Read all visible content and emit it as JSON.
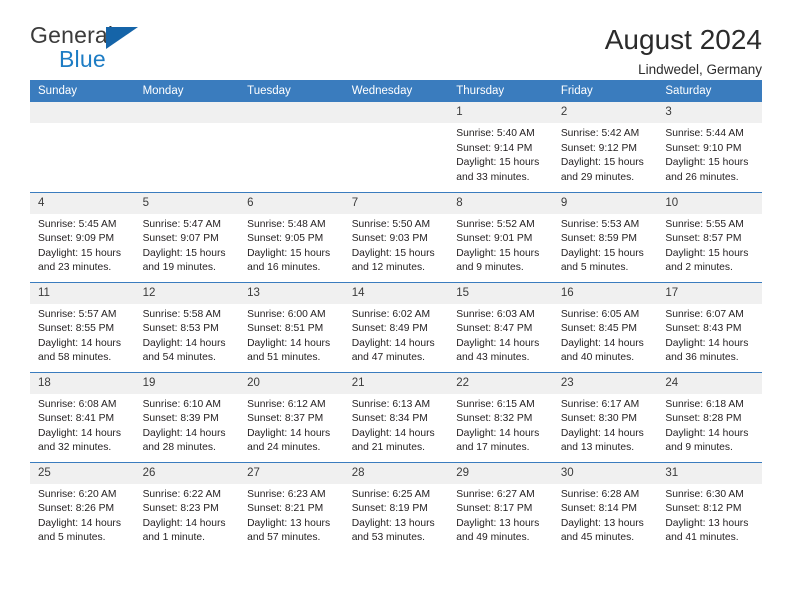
{
  "logo": {
    "word_one": "General",
    "word_two": "Blue",
    "triangle_icon": "blue-triangle-icon",
    "brand_color": "#1d7cc4"
  },
  "header": {
    "title": "August 2024",
    "subtitle": "Lindwedel, Germany"
  },
  "calendar": {
    "header_bg": "#3a7cbe",
    "daynum_bg": "#f0f0f0",
    "weekday_headers": [
      "Sunday",
      "Monday",
      "Tuesday",
      "Wednesday",
      "Thursday",
      "Friday",
      "Saturday"
    ],
    "weeks": [
      [
        {
          "day": "",
          "sunrise": "",
          "sunset": "",
          "daylight1": "",
          "daylight2": "",
          "empty": true
        },
        {
          "day": "",
          "sunrise": "",
          "sunset": "",
          "daylight1": "",
          "daylight2": "",
          "empty": true
        },
        {
          "day": "",
          "sunrise": "",
          "sunset": "",
          "daylight1": "",
          "daylight2": "",
          "empty": true
        },
        {
          "day": "",
          "sunrise": "",
          "sunset": "",
          "daylight1": "",
          "daylight2": "",
          "empty": true
        },
        {
          "day": "1",
          "sunrise": "Sunrise: 5:40 AM",
          "sunset": "Sunset: 9:14 PM",
          "daylight1": "Daylight: 15 hours",
          "daylight2": "and 33 minutes."
        },
        {
          "day": "2",
          "sunrise": "Sunrise: 5:42 AM",
          "sunset": "Sunset: 9:12 PM",
          "daylight1": "Daylight: 15 hours",
          "daylight2": "and 29 minutes."
        },
        {
          "day": "3",
          "sunrise": "Sunrise: 5:44 AM",
          "sunset": "Sunset: 9:10 PM",
          "daylight1": "Daylight: 15 hours",
          "daylight2": "and 26 minutes."
        }
      ],
      [
        {
          "day": "4",
          "sunrise": "Sunrise: 5:45 AM",
          "sunset": "Sunset: 9:09 PM",
          "daylight1": "Daylight: 15 hours",
          "daylight2": "and 23 minutes."
        },
        {
          "day": "5",
          "sunrise": "Sunrise: 5:47 AM",
          "sunset": "Sunset: 9:07 PM",
          "daylight1": "Daylight: 15 hours",
          "daylight2": "and 19 minutes."
        },
        {
          "day": "6",
          "sunrise": "Sunrise: 5:48 AM",
          "sunset": "Sunset: 9:05 PM",
          "daylight1": "Daylight: 15 hours",
          "daylight2": "and 16 minutes."
        },
        {
          "day": "7",
          "sunrise": "Sunrise: 5:50 AM",
          "sunset": "Sunset: 9:03 PM",
          "daylight1": "Daylight: 15 hours",
          "daylight2": "and 12 minutes."
        },
        {
          "day": "8",
          "sunrise": "Sunrise: 5:52 AM",
          "sunset": "Sunset: 9:01 PM",
          "daylight1": "Daylight: 15 hours",
          "daylight2": "and 9 minutes."
        },
        {
          "day": "9",
          "sunrise": "Sunrise: 5:53 AM",
          "sunset": "Sunset: 8:59 PM",
          "daylight1": "Daylight: 15 hours",
          "daylight2": "and 5 minutes."
        },
        {
          "day": "10",
          "sunrise": "Sunrise: 5:55 AM",
          "sunset": "Sunset: 8:57 PM",
          "daylight1": "Daylight: 15 hours",
          "daylight2": "and 2 minutes."
        }
      ],
      [
        {
          "day": "11",
          "sunrise": "Sunrise: 5:57 AM",
          "sunset": "Sunset: 8:55 PM",
          "daylight1": "Daylight: 14 hours",
          "daylight2": "and 58 minutes."
        },
        {
          "day": "12",
          "sunrise": "Sunrise: 5:58 AM",
          "sunset": "Sunset: 8:53 PM",
          "daylight1": "Daylight: 14 hours",
          "daylight2": "and 54 minutes."
        },
        {
          "day": "13",
          "sunrise": "Sunrise: 6:00 AM",
          "sunset": "Sunset: 8:51 PM",
          "daylight1": "Daylight: 14 hours",
          "daylight2": "and 51 minutes."
        },
        {
          "day": "14",
          "sunrise": "Sunrise: 6:02 AM",
          "sunset": "Sunset: 8:49 PM",
          "daylight1": "Daylight: 14 hours",
          "daylight2": "and 47 minutes."
        },
        {
          "day": "15",
          "sunrise": "Sunrise: 6:03 AM",
          "sunset": "Sunset: 8:47 PM",
          "daylight1": "Daylight: 14 hours",
          "daylight2": "and 43 minutes."
        },
        {
          "day": "16",
          "sunrise": "Sunrise: 6:05 AM",
          "sunset": "Sunset: 8:45 PM",
          "daylight1": "Daylight: 14 hours",
          "daylight2": "and 40 minutes."
        },
        {
          "day": "17",
          "sunrise": "Sunrise: 6:07 AM",
          "sunset": "Sunset: 8:43 PM",
          "daylight1": "Daylight: 14 hours",
          "daylight2": "and 36 minutes."
        }
      ],
      [
        {
          "day": "18",
          "sunrise": "Sunrise: 6:08 AM",
          "sunset": "Sunset: 8:41 PM",
          "daylight1": "Daylight: 14 hours",
          "daylight2": "and 32 minutes."
        },
        {
          "day": "19",
          "sunrise": "Sunrise: 6:10 AM",
          "sunset": "Sunset: 8:39 PM",
          "daylight1": "Daylight: 14 hours",
          "daylight2": "and 28 minutes."
        },
        {
          "day": "20",
          "sunrise": "Sunrise: 6:12 AM",
          "sunset": "Sunset: 8:37 PM",
          "daylight1": "Daylight: 14 hours",
          "daylight2": "and 24 minutes."
        },
        {
          "day": "21",
          "sunrise": "Sunrise: 6:13 AM",
          "sunset": "Sunset: 8:34 PM",
          "daylight1": "Daylight: 14 hours",
          "daylight2": "and 21 minutes."
        },
        {
          "day": "22",
          "sunrise": "Sunrise: 6:15 AM",
          "sunset": "Sunset: 8:32 PM",
          "daylight1": "Daylight: 14 hours",
          "daylight2": "and 17 minutes."
        },
        {
          "day": "23",
          "sunrise": "Sunrise: 6:17 AM",
          "sunset": "Sunset: 8:30 PM",
          "daylight1": "Daylight: 14 hours",
          "daylight2": "and 13 minutes."
        },
        {
          "day": "24",
          "sunrise": "Sunrise: 6:18 AM",
          "sunset": "Sunset: 8:28 PM",
          "daylight1": "Daylight: 14 hours",
          "daylight2": "and 9 minutes."
        }
      ],
      [
        {
          "day": "25",
          "sunrise": "Sunrise: 6:20 AM",
          "sunset": "Sunset: 8:26 PM",
          "daylight1": "Daylight: 14 hours",
          "daylight2": "and 5 minutes."
        },
        {
          "day": "26",
          "sunrise": "Sunrise: 6:22 AM",
          "sunset": "Sunset: 8:23 PM",
          "daylight1": "Daylight: 14 hours",
          "daylight2": "and 1 minute."
        },
        {
          "day": "27",
          "sunrise": "Sunrise: 6:23 AM",
          "sunset": "Sunset: 8:21 PM",
          "daylight1": "Daylight: 13 hours",
          "daylight2": "and 57 minutes."
        },
        {
          "day": "28",
          "sunrise": "Sunrise: 6:25 AM",
          "sunset": "Sunset: 8:19 PM",
          "daylight1": "Daylight: 13 hours",
          "daylight2": "and 53 minutes."
        },
        {
          "day": "29",
          "sunrise": "Sunrise: 6:27 AM",
          "sunset": "Sunset: 8:17 PM",
          "daylight1": "Daylight: 13 hours",
          "daylight2": "and 49 minutes."
        },
        {
          "day": "30",
          "sunrise": "Sunrise: 6:28 AM",
          "sunset": "Sunset: 8:14 PM",
          "daylight1": "Daylight: 13 hours",
          "daylight2": "and 45 minutes."
        },
        {
          "day": "31",
          "sunrise": "Sunrise: 6:30 AM",
          "sunset": "Sunset: 8:12 PM",
          "daylight1": "Daylight: 13 hours",
          "daylight2": "and 41 minutes."
        }
      ]
    ]
  }
}
